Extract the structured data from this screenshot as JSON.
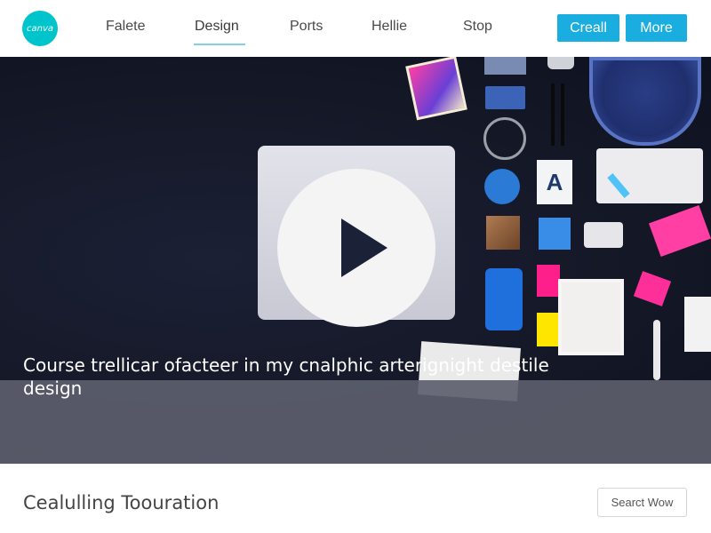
{
  "header": {
    "logo_text": "canva",
    "nav": [
      {
        "label": "Falete"
      },
      {
        "label": "Design"
      },
      {
        "label": "Ports"
      },
      {
        "label": "Hellie"
      },
      {
        "label": "Stop"
      }
    ],
    "active_nav": "Design",
    "buttons": {
      "create_label": "Creall",
      "more_label": "More"
    }
  },
  "hero": {
    "caption": "Course trellicar ofacteer in my cnalphic arterignight destile design",
    "play_icon": "play-icon"
  },
  "section": {
    "title": "Cealulling Toouration",
    "search_button_label": "Searct Wow"
  },
  "colors": {
    "accent": "#1aaee0",
    "logo": "#00c4cc",
    "hero_bg": "#141827",
    "caption_band": "#5c5e6c"
  }
}
